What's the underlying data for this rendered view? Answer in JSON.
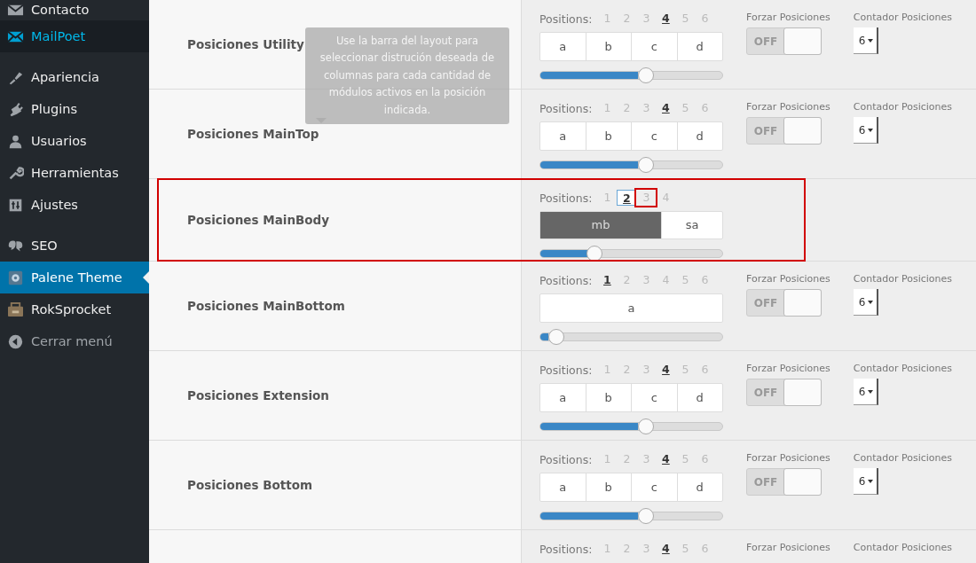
{
  "sidebar": {
    "items": [
      {
        "kind": "item",
        "label": "Contacto",
        "selected": false,
        "current": false
      },
      {
        "kind": "item",
        "label": "MailPoet",
        "selected": false,
        "current": true
      },
      {
        "kind": "separator"
      },
      {
        "kind": "item",
        "label": "Apariencia",
        "selected": false,
        "current": false
      },
      {
        "kind": "item",
        "label": "Plugins",
        "selected": false,
        "current": false
      },
      {
        "kind": "item",
        "label": "Usuarios",
        "selected": false,
        "current": false
      },
      {
        "kind": "item",
        "label": "Herramientas",
        "selected": false,
        "current": false
      },
      {
        "kind": "item",
        "label": "Ajustes",
        "selected": false,
        "current": false
      },
      {
        "kind": "separator"
      },
      {
        "kind": "item",
        "label": "SEO",
        "selected": false,
        "current": false
      },
      {
        "kind": "item",
        "label": "Palene Theme",
        "selected": true,
        "current": false
      },
      {
        "kind": "item",
        "label": "RokSprocket",
        "selected": false,
        "current": false
      },
      {
        "kind": "collapse",
        "label": "Cerrar menú",
        "selected": false,
        "current": false
      }
    ]
  },
  "tooltip": {
    "text": "Use la barra del layout para seleccionar distrución deseada de columnas para cada cantidad de módulos activos en la posición indicada."
  },
  "rows": [
    {
      "title": "Posiciones Utility",
      "positions_label": "Positions:",
      "positions": [
        {
          "label": "1",
          "selected": false
        },
        {
          "label": "2",
          "selected": false
        },
        {
          "label": "3",
          "selected": false
        },
        {
          "label": "4",
          "selected": true
        },
        {
          "label": "5",
          "selected": false
        },
        {
          "label": "6",
          "selected": false
        }
      ],
      "cells": [
        {
          "label": "a",
          "selected": false
        },
        {
          "label": "b",
          "selected": false
        },
        {
          "label": "c",
          "selected": false
        },
        {
          "label": "d",
          "selected": false
        }
      ],
      "level": 0.58,
      "forzar": {
        "label": "Forzar Posiciones",
        "state_label": "OFF",
        "on": false
      },
      "contador": {
        "label": "Contador Posiciones",
        "value": "6"
      }
    },
    {
      "title": "Posiciones MainTop",
      "positions_label": "Positions:",
      "positions": [
        {
          "label": "1",
          "selected": false
        },
        {
          "label": "2",
          "selected": false
        },
        {
          "label": "3",
          "selected": false
        },
        {
          "label": "4",
          "selected": true
        },
        {
          "label": "5",
          "selected": false
        },
        {
          "label": "6",
          "selected": false
        }
      ],
      "cells": [
        {
          "label": "a",
          "selected": false
        },
        {
          "label": "b",
          "selected": false
        },
        {
          "label": "c",
          "selected": false
        },
        {
          "label": "d",
          "selected": false
        }
      ],
      "level": 0.58,
      "forzar": {
        "label": "Forzar Posiciones",
        "state_label": "OFF",
        "on": false
      },
      "contador": {
        "label": "Contador Posiciones",
        "value": "6"
      }
    },
    {
      "title": "Posiciones MainBody",
      "highlighted": true,
      "positions_label": "Positions:",
      "positions": [
        {
          "label": "1",
          "selected": false,
          "focused": false,
          "marked": false
        },
        {
          "label": "2",
          "selected": true,
          "focused": true,
          "marked": false
        },
        {
          "label": "3",
          "selected": false,
          "focused": false,
          "marked": true
        },
        {
          "label": "4",
          "selected": false,
          "focused": false,
          "marked": false
        }
      ],
      "cells": [
        {
          "label": "mb",
          "selected": true
        },
        {
          "label": "sa",
          "selected": false
        }
      ],
      "level": 0.3
    },
    {
      "title": "Posiciones MainBottom",
      "positions_label": "Positions:",
      "positions": [
        {
          "label": "1",
          "selected": true
        },
        {
          "label": "2",
          "selected": false
        },
        {
          "label": "3",
          "selected": false
        },
        {
          "label": "4",
          "selected": false
        },
        {
          "label": "5",
          "selected": false
        },
        {
          "label": "6",
          "selected": false
        }
      ],
      "cells": [
        {
          "label": "a",
          "selected": false
        }
      ],
      "level": 0.09,
      "forzar": {
        "label": "Forzar Posiciones",
        "state_label": "OFF",
        "on": false
      },
      "contador": {
        "label": "Contador Posiciones",
        "value": "6"
      }
    },
    {
      "title": "Posiciones Extension",
      "positions_label": "Positions:",
      "positions": [
        {
          "label": "1",
          "selected": false
        },
        {
          "label": "2",
          "selected": false
        },
        {
          "label": "3",
          "selected": false
        },
        {
          "label": "4",
          "selected": true
        },
        {
          "label": "5",
          "selected": false
        },
        {
          "label": "6",
          "selected": false
        }
      ],
      "cells": [
        {
          "label": "a",
          "selected": false
        },
        {
          "label": "b",
          "selected": false
        },
        {
          "label": "c",
          "selected": false
        },
        {
          "label": "d",
          "selected": false
        }
      ],
      "level": 0.58,
      "forzar": {
        "label": "Forzar Posiciones",
        "state_label": "OFF",
        "on": false
      },
      "contador": {
        "label": "Contador Posiciones",
        "value": "6"
      }
    },
    {
      "title": "Posiciones Bottom",
      "positions_label": "Positions:",
      "positions": [
        {
          "label": "1",
          "selected": false
        },
        {
          "label": "2",
          "selected": false
        },
        {
          "label": "3",
          "selected": false
        },
        {
          "label": "4",
          "selected": true
        },
        {
          "label": "5",
          "selected": false
        },
        {
          "label": "6",
          "selected": false
        }
      ],
      "cells": [
        {
          "label": "a",
          "selected": false
        },
        {
          "label": "b",
          "selected": false
        },
        {
          "label": "c",
          "selected": false
        },
        {
          "label": "d",
          "selected": false
        }
      ],
      "level": 0.58,
      "forzar": {
        "label": "Forzar Posiciones",
        "state_label": "OFF",
        "on": false
      },
      "contador": {
        "label": "Contador Posiciones",
        "value": "6"
      }
    },
    {
      "positions_label": "Positions:",
      "positions": [
        {
          "label": "1",
          "selected": false
        },
        {
          "label": "2",
          "selected": false
        },
        {
          "label": "3",
          "selected": false
        },
        {
          "label": "4",
          "selected": true
        },
        {
          "label": "5",
          "selected": false
        },
        {
          "label": "6",
          "selected": false
        }
      ],
      "forzar": {
        "label": "Forzar Posiciones"
      },
      "contador": {
        "label": "Contador Posiciones"
      }
    }
  ]
}
